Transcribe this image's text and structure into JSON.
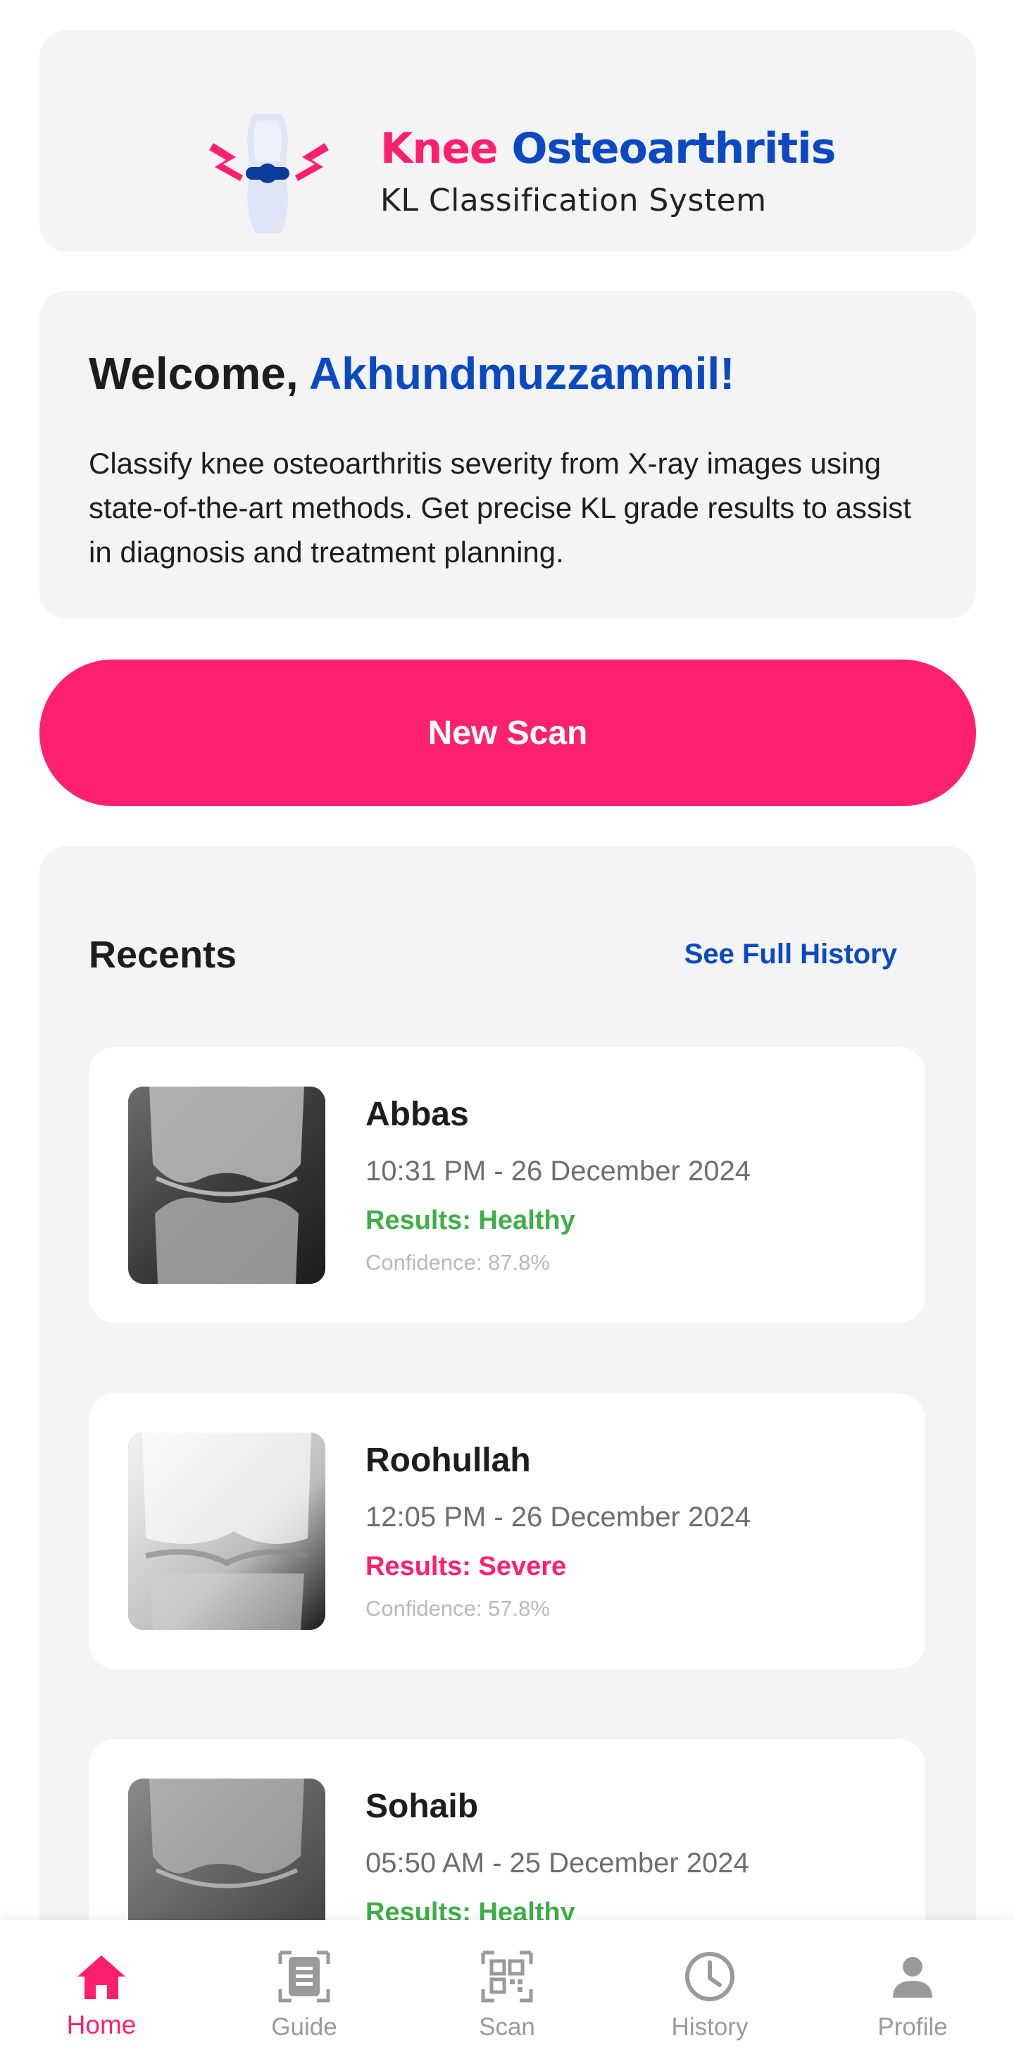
{
  "colors": {
    "brand_pink": "#ff1f6e",
    "brand_blue": "#0a49c2",
    "healthy_green": "#3fae49",
    "severe_pink": "#ff1f6e"
  },
  "header": {
    "title_part1": "Knee",
    "title_part2": "Osteoarthritis",
    "subtitle": "KL Classification System",
    "logo_icon": "knee-joint-logo-icon"
  },
  "welcome": {
    "greeting": "Welcome, ",
    "name": "Akhundmuzzammil!",
    "description": "Classify knee osteoarthritis severity from X-ray images using state-of-the-art methods. Get precise KL grade results to assist in diagnosis and treatment planning."
  },
  "actions": {
    "new_scan_label": "New Scan"
  },
  "recents": {
    "title": "Recents",
    "see_full_history": "See Full History",
    "items": [
      {
        "name": "Abbas",
        "datetime": "10:31 PM - 26 December 2024",
        "result": "Results: Healthy",
        "result_status": "healthy",
        "confidence": "Confidence: 87.8%"
      },
      {
        "name": "Roohullah",
        "datetime": "12:05 PM - 26 December 2024",
        "result": "Results: Severe",
        "result_status": "severe",
        "confidence": "Confidence: 57.8%"
      },
      {
        "name": "Sohaib",
        "datetime": "05:50 AM - 25 December 2024",
        "result": "Results: Healthy",
        "result_status": "healthy",
        "confidence": ""
      }
    ]
  },
  "nav": {
    "items": [
      {
        "label": "Home",
        "icon": "home-icon",
        "active": true
      },
      {
        "label": "Guide",
        "icon": "guide-icon",
        "active": false
      },
      {
        "label": "Scan",
        "icon": "qr-scan-icon",
        "active": false
      },
      {
        "label": "History",
        "icon": "clock-icon",
        "active": false
      },
      {
        "label": "Profile",
        "icon": "person-icon",
        "active": false
      }
    ]
  }
}
